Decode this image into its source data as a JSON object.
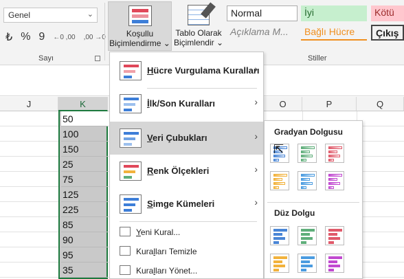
{
  "ribbon": {
    "number_format_value": "Genel",
    "number_group_label": "Sayı",
    "conditional_formatting_line1": "Koşullu",
    "conditional_formatting_line2": "Biçimlendirme ⌄",
    "format_as_table_line1": "Tablo Olarak",
    "format_as_table_line2": "Biçimlendir ⌄",
    "styles_group_label": "Stiller",
    "styles": {
      "normal": "Normal",
      "iyi": "İyi",
      "kotu": "Kötü",
      "aciklama": "Açıklama M...",
      "bagli_hucre": "Bağlı Hücre",
      "cikis": "Çıkış"
    },
    "number_buttons": [
      "₺",
      "%",
      "9",
      "←0 ,00",
      ",00 →0"
    ]
  },
  "columns": {
    "J": "J",
    "K": "K",
    "O": "O",
    "P": "P",
    "Q": "Q"
  },
  "k_values": [
    "50",
    "100",
    "150",
    "25",
    "75",
    "125",
    "225",
    "85",
    "90",
    "95",
    "35"
  ],
  "menu": {
    "hucre": {
      "u": "H",
      "rest": "ücre Vurgulama Kuralları"
    },
    "ilk": {
      "u": "İ",
      "rest": "lk/Son Kuralları"
    },
    "veri": {
      "u": "V",
      "rest": "eri Çubukları"
    },
    "renk": {
      "u": "R",
      "rest": "enk Ölçekleri"
    },
    "simge": {
      "u": "S",
      "rest": "imge Kümeleri"
    },
    "yeni": {
      "u": "Y",
      "rest": "eni Kural..."
    },
    "temizle": {
      "pre": "Kura",
      "u": "l",
      "rest": "ları Temizle"
    },
    "yonet": {
      "pre": "Kura",
      "u": "l",
      "rest": "ları Yönet..."
    }
  },
  "submenu": {
    "gradient_header": "Gradyan Dolgusu",
    "solid_header": "Düz Dolgu",
    "colors": [
      "#4a86d6",
      "#5fae7a",
      "#e05a6a",
      "#f2b23c",
      "#4a9be0",
      "#c14ad0"
    ]
  },
  "colors": {
    "accent_green": "#1d7a3e",
    "iyi_bg": "#c6efce",
    "kotu_bg": "#ffc7ce",
    "aciklama_text": "#7f7f7f",
    "bagli_text": "#f08f1e"
  }
}
